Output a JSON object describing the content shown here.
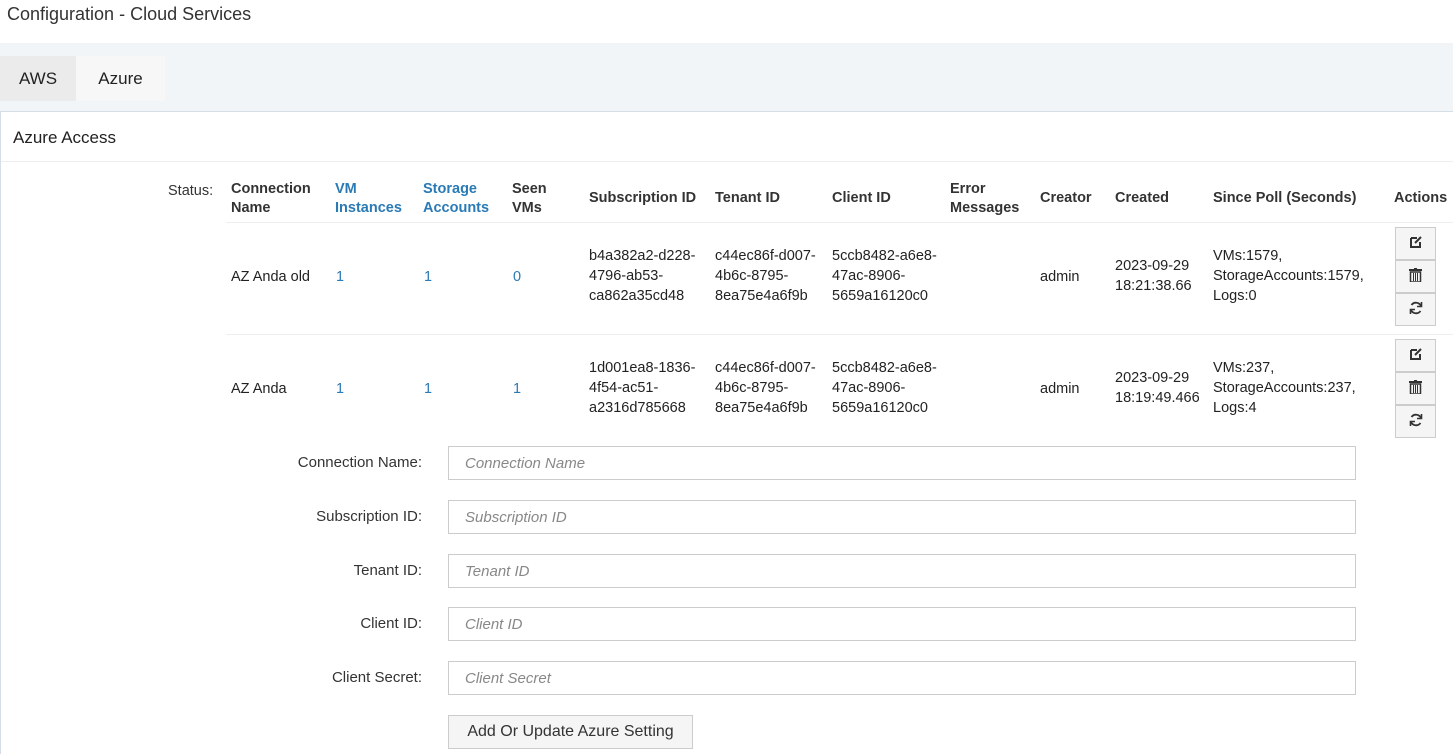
{
  "page_title": "Configuration - Cloud Services",
  "tabs": [
    {
      "label": "AWS"
    },
    {
      "label": "Azure"
    }
  ],
  "panel_title": "Azure Access",
  "table": {
    "status_label": "Status:",
    "headers": {
      "connection_name": [
        "Connection",
        "Name"
      ],
      "vm_instances": [
        "VM",
        "Instances"
      ],
      "storage_accounts": [
        "Storage",
        "Accounts"
      ],
      "seen_vms": [
        "Seen",
        "VMs"
      ],
      "subscription_id": "Subscription ID",
      "tenant_id": "Tenant ID",
      "client_id": "Client ID",
      "error_messages": [
        "Error",
        "Messages"
      ],
      "creator": "Creator",
      "created": "Created",
      "since_poll": "Since Poll (Seconds)",
      "actions": "Actions"
    },
    "rows": [
      {
        "name": "AZ Anda old",
        "vm": "1",
        "storage": "1",
        "seen": "0",
        "sub": [
          "b4a382a2-d228-",
          "4796-ab53-",
          "ca862a35cd48"
        ],
        "tenant": [
          "c44ec86f-d007-",
          "4b6c-8795-",
          "8ea75e4a6f9b"
        ],
        "client": [
          "5ccb8482-a6e8-",
          "47ac-8906-",
          "5659a16120c0"
        ],
        "error": "",
        "creator": "admin",
        "created": [
          "2023-09-29",
          "18:21:38.66"
        ],
        "poll": [
          "VMs:1579,",
          "StorageAccounts:1579,",
          "Logs:0"
        ]
      },
      {
        "name": "AZ Anda",
        "vm": "1",
        "storage": "1",
        "seen": "1",
        "sub": [
          "1d001ea8-1836-",
          "4f54-ac51-",
          "a2316d785668"
        ],
        "tenant": [
          "c44ec86f-d007-",
          "4b6c-8795-",
          "8ea75e4a6f9b"
        ],
        "client": [
          "5ccb8482-a6e8-",
          "47ac-8906-",
          "5659a16120c0"
        ],
        "error": "",
        "creator": "admin",
        "created": [
          "2023-09-29",
          "18:19:49.466"
        ],
        "poll": [
          "VMs:237,",
          "StorageAccounts:237,",
          "Logs:4"
        ]
      }
    ]
  },
  "form": {
    "fields": [
      {
        "label": "Connection Name:",
        "placeholder": "Connection Name",
        "value": ""
      },
      {
        "label": "Subscription ID:",
        "placeholder": "Subscription ID",
        "value": ""
      },
      {
        "label": "Tenant ID:",
        "placeholder": "Tenant ID",
        "value": ""
      },
      {
        "label": "Client ID:",
        "placeholder": "Client ID",
        "value": ""
      },
      {
        "label": "Client Secret:",
        "placeholder": "Client Secret",
        "value": ""
      }
    ],
    "submit_label": "Add Or Update Azure Setting"
  },
  "colors": {
    "link": "#2a7ab5",
    "tabbar": "#f2f5f8"
  },
  "icons": {
    "edit": "edit-icon",
    "delete": "trash-icon",
    "refresh": "refresh-icon"
  }
}
